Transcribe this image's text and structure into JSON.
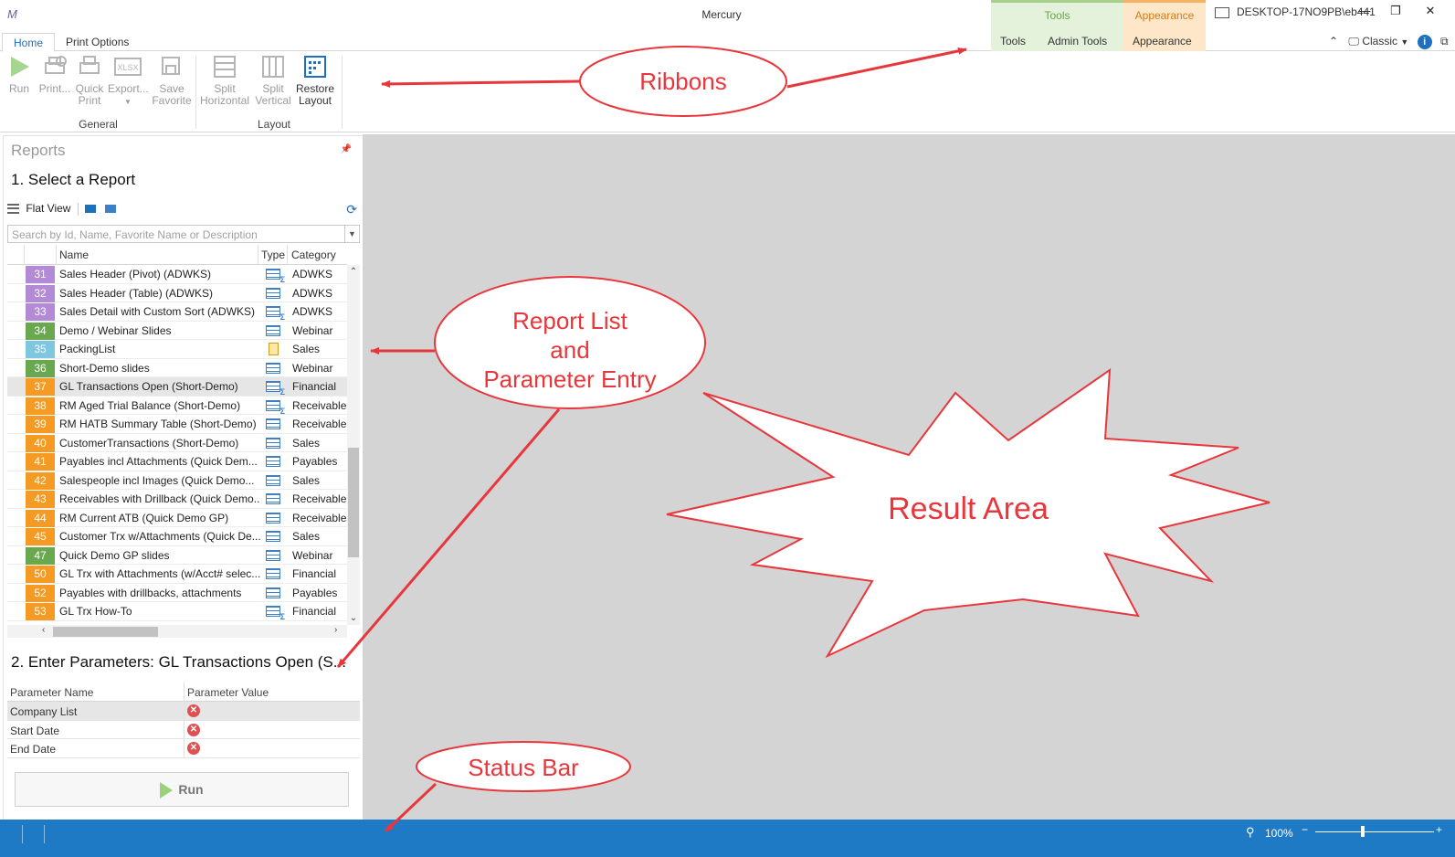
{
  "window": {
    "title": "Mercury",
    "user": "DESKTOP-17NO9PB\\eb441",
    "minimize": "—",
    "restore": "❐",
    "close": "✕"
  },
  "context_headers": {
    "tools": "Tools",
    "appearance": "Appearance"
  },
  "tabs": {
    "home": "Home",
    "print_options": "Print Options",
    "tools": "Tools",
    "admin_tools": "Admin Tools",
    "appearance": "Appearance"
  },
  "right_tools": {
    "theme": "Classic"
  },
  "ribbon": {
    "run": "Run",
    "print": "Print...",
    "quick_print_1": "Quick",
    "quick_print_2": "Print",
    "export": "Export...",
    "save_fav_1": "Save",
    "save_fav_2": "Favorite",
    "general_label": "General",
    "split_h_1": "Split",
    "split_h_2": "Horizontal",
    "split_v_1": "Split",
    "split_v_2": "Vertical",
    "restore_1": "Restore",
    "restore_2": "Layout",
    "layout_label": "Layout",
    "xlsx": "XLSX"
  },
  "panel": {
    "title": "Reports",
    "select_heading": "1. Select a Report",
    "flat_view": "Flat View",
    "search_placeholder": "Search by Id, Name, Favorite Name or Description",
    "col_name": "Name",
    "col_type": "Type",
    "col_category": "Category"
  },
  "reports": [
    {
      "id": "31",
      "name": "Sales Header (Pivot) (ADWKS)",
      "type": "pivot",
      "category": "ADWKS",
      "color": "#b38ad6"
    },
    {
      "id": "32",
      "name": "Sales Header (Table) (ADWKS)",
      "type": "table",
      "category": "ADWKS",
      "color": "#b38ad6"
    },
    {
      "id": "33",
      "name": "Sales Detail with Custom Sort (ADWKS)",
      "type": "pivot",
      "category": "ADWKS",
      "color": "#b38ad6"
    },
    {
      "id": "34",
      "name": "Demo / Webinar Slides",
      "type": "table",
      "category": "Webinar",
      "color": "#6aa84f"
    },
    {
      "id": "35",
      "name": "PackingList",
      "type": "clipboard",
      "category": "Sales",
      "color": "#7fc6e0"
    },
    {
      "id": "36",
      "name": "Short-Demo slides",
      "type": "table",
      "category": "Webinar",
      "color": "#6aa84f"
    },
    {
      "id": "37",
      "name": "GL Transactions Open (Short-Demo)",
      "type": "pivot",
      "category": "Financial",
      "color": "#f59a23"
    },
    {
      "id": "38",
      "name": "RM Aged Trial Balance (Short-Demo)",
      "type": "pivot",
      "category": "Receivables",
      "color": "#f59a23"
    },
    {
      "id": "39",
      "name": "RM HATB Summary Table (Short-Demo)",
      "type": "table",
      "category": "Receivables",
      "color": "#f59a23"
    },
    {
      "id": "40",
      "name": "CustomerTransactions (Short-Demo)",
      "type": "table",
      "category": "Sales",
      "color": "#f59a23"
    },
    {
      "id": "41",
      "name": "Payables incl Attachments (Quick Dem...",
      "type": "table",
      "category": "Payables",
      "color": "#f59a23"
    },
    {
      "id": "42",
      "name": "Salespeople incl Images (Quick Demo...",
      "type": "table",
      "category": "Sales",
      "color": "#f59a23"
    },
    {
      "id": "43",
      "name": "Receivables with Drillback (Quick Demo...",
      "type": "table",
      "category": "Receivables",
      "color": "#f59a23"
    },
    {
      "id": "44",
      "name": "RM Current ATB  (Quick Demo GP)",
      "type": "table",
      "category": "Receivables",
      "color": "#f59a23"
    },
    {
      "id": "45",
      "name": "Customer Trx w/Attachments (Quick De...",
      "type": "table",
      "category": "Sales",
      "color": "#f59a23"
    },
    {
      "id": "47",
      "name": "Quick Demo GP slides",
      "type": "table",
      "category": "Webinar",
      "color": "#6aa84f"
    },
    {
      "id": "50",
      "name": "GL Trx with Attachments (w/Acct# selec...",
      "type": "table",
      "category": "Financial",
      "color": "#f59a23"
    },
    {
      "id": "52",
      "name": "Payables with drillbacks, attachments",
      "type": "table",
      "category": "Payables",
      "color": "#f59a23"
    },
    {
      "id": "53",
      "name": "GL Trx How-To",
      "type": "pivot",
      "category": "Financial",
      "color": "#f59a23"
    }
  ],
  "selected_report_id": "37",
  "params": {
    "heading": "2. Enter Parameters:  GL Transactions Open (S...",
    "col_name": "Parameter Name",
    "col_value": "Parameter Value",
    "rows": [
      "Company List",
      "Start Date",
      "End Date"
    ],
    "run_label": "Run"
  },
  "statusbar": {
    "zoom": "100%"
  },
  "annotations": {
    "ribbons": "Ribbons",
    "report_list_1": "Report List",
    "report_list_2": "and",
    "report_list_3": "Parameter Entry",
    "result_area": "Result Area",
    "status_bar": "Status Bar"
  },
  "colors": {
    "accent": "#1f6fbf",
    "statusbar": "#1f7ac6",
    "annotation": "#e8373c",
    "result_bg": "#d4d4d4"
  }
}
